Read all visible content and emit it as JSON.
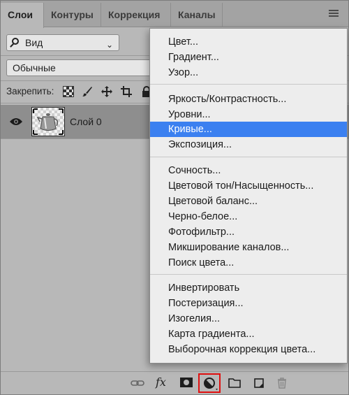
{
  "tabs": [
    "Слои",
    "Контуры",
    "Коррекция",
    "Каналы"
  ],
  "filter": {
    "label": "Вид"
  },
  "blend_mode": "Обычные",
  "lock": {
    "label": "Закрепить:"
  },
  "layer": {
    "name": "Слой 0"
  },
  "bottom": {
    "fx_label": "fx"
  },
  "menu": {
    "group1": [
      "Цвет...",
      "Градиент...",
      "Узор..."
    ],
    "group2": [
      "Яркость/Контрастность...",
      "Уровни...",
      "Кривые...",
      "Экспозиция..."
    ],
    "group3": [
      "Сочность...",
      "Цветовой тон/Насыщенность...",
      "Цветовой баланс...",
      "Черно-белое...",
      "Фотофильтр...",
      "Микширование каналов...",
      "Поиск цвета..."
    ],
    "group4": [
      "Инвертировать",
      "Постеризация...",
      "Изогелия...",
      "Карта градиента...",
      "Выборочная коррекция цвета..."
    ],
    "selected": "Кривые..."
  },
  "colors": {
    "highlight": "#3b80f0",
    "accent_box": "#e01010"
  }
}
